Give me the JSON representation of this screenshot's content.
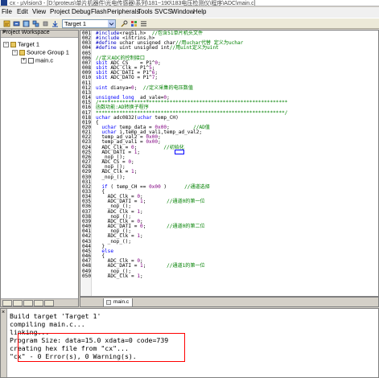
{
  "window": {
    "title": "cx - µVision3 - [D:\\proteus\\单片机器件\\光电传感器\\系列\\181~190\\183电压检测仪\\程序\\ADC\\main.c]"
  },
  "menubar": {
    "items": [
      "File",
      "Edit",
      "View",
      "Project",
      "Debug",
      "Flash",
      "Peripherals",
      "Tools",
      "SVCS",
      "Window",
      "Help"
    ]
  },
  "toolbar": {
    "target": "Target 1"
  },
  "workspace": {
    "title": "Project Workspace",
    "close": "×",
    "tree": [
      {
        "label": "Target 1",
        "icon": "folder-icon",
        "expander": "−"
      },
      {
        "label": "Source Group 1",
        "icon": "folder-icon",
        "expander": "−"
      },
      {
        "label": "main.c",
        "icon": "file-icon",
        "expander": "+"
      }
    ]
  },
  "editor": {
    "tab": "main.c",
    "lines": [
      {
        "n": "001",
        "code": "#include<reg51.h>  //包含51单片机头文件"
      },
      {
        "n": "002",
        "code": "#include <intrins.h>"
      },
      {
        "n": "003",
        "code": "#define uchar unsigned char//用uchar代替 定义为uchar"
      },
      {
        "n": "004",
        "code": "#define uint unsigned int//用uint定义为uint"
      },
      {
        "n": "005",
        "code": ""
      },
      {
        "n": "006",
        "code": "//定义ADC的控制接口"
      },
      {
        "n": "007",
        "code": "sbit ADC_CS    = P1^0;"
      },
      {
        "n": "008",
        "code": "sbit ADC_Clk = P1^5;"
      },
      {
        "n": "009",
        "code": "sbit ADC_DATI = P1^6;"
      },
      {
        "n": "010",
        "code": "sbit ADC_DATO = P1^7;"
      },
      {
        "n": "011",
        "code": ""
      },
      {
        "n": "012",
        "code": "uint dianya=0;  //定义采集的电压数值"
      },
      {
        "n": "013",
        "code": ""
      },
      {
        "n": "014",
        "code": "unsigned long  ad_vale=0;"
      },
      {
        "n": "015",
        "code": "/****************************************************************"
      },
      {
        "n": "016",
        "code": "函数功能:AD转换子程序"
      },
      {
        "n": "017",
        "code": "****************************************************************/"
      },
      {
        "n": "018",
        "code": "uchar adc0832(uchar temp_CH)"
      },
      {
        "n": "019",
        "code": "{"
      },
      {
        "n": "020",
        "code": "  uchar temp_data = 0x00;        //AD值"
      },
      {
        "n": "021",
        "code": "  uchar i,temp_ad_val1,temp_ad_val2;"
      },
      {
        "n": "022",
        "code": "  temp_ad_val2 = 0x00;"
      },
      {
        "n": "023",
        "code": "  temp_ad_val1 = 0x00;"
      },
      {
        "n": "024",
        "code": "  ADC_Clk = 0;         //初始化"
      },
      {
        "n": "025",
        "code": "  ADC_DATI = 1;"
      },
      {
        "n": "026",
        "code": "  _nop_();"
      },
      {
        "n": "027",
        "code": "  ADC_CS = 0;"
      },
      {
        "n": "028",
        "code": "  _nop_();"
      },
      {
        "n": "029",
        "code": "  ADC_Clk = 1;"
      },
      {
        "n": "030",
        "code": "  _nop_();"
      },
      {
        "n": "031",
        "code": ""
      },
      {
        "n": "032",
        "code": "  if ( temp_CH == 0x00 )      //通道选择"
      },
      {
        "n": "033",
        "code": "  {"
      },
      {
        "n": "034",
        "code": "    ADC_Clk = 0;"
      },
      {
        "n": "035",
        "code": "    ADC_DATI = 1;       //通道0的第一位"
      },
      {
        "n": "036",
        "code": "    _nop_();"
      },
      {
        "n": "037",
        "code": "    ADC_Clk = 1;"
      },
      {
        "n": "038",
        "code": "    _nop_();"
      },
      {
        "n": "039",
        "code": "    ADC_Clk = 0;"
      },
      {
        "n": "040",
        "code": "    ADC_DATI = 0;       //通道0的第二位"
      },
      {
        "n": "041",
        "code": "    _nop_();"
      },
      {
        "n": "042",
        "code": "    ADC_Clk = 1;"
      },
      {
        "n": "043",
        "code": "    _nop_();"
      },
      {
        "n": "044",
        "code": "  }"
      },
      {
        "n": "045",
        "code": "  else"
      },
      {
        "n": "046",
        "code": "  {"
      },
      {
        "n": "047",
        "code": "    ADC_Clk = 0;"
      },
      {
        "n": "048",
        "code": "    ADC_DATI = 1;       //通道1的第一位"
      },
      {
        "n": "049",
        "code": "    _nop_();"
      },
      {
        "n": "050",
        "code": "    ADC_Clk = 1;"
      }
    ]
  },
  "output": {
    "close": "×",
    "lines": [
      "Build target 'Target 1'",
      "compiling main.c...",
      "linking...",
      "Program Size: data=15.0 xdata=0 code=739",
      "creating hex file from \"cx\"...",
      "\"cx\" - 0 Error(s), 0 Warning(s)."
    ]
  },
  "colors": {
    "keyword": "#0000ff",
    "comment": "#008000",
    "number": "#800080",
    "highlight": "#ff0000"
  }
}
